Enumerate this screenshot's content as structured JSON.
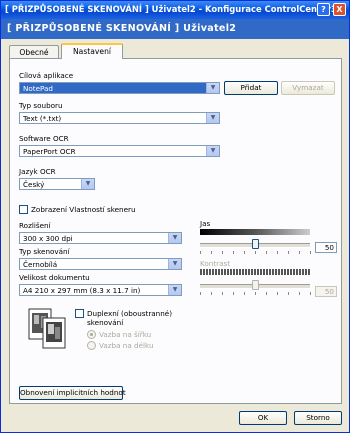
{
  "window": {
    "title": "[ PŘIZPŮSOBENÉ SKENOVÁNÍ ]  Uživatel2 - Konfigurace ControlCenter3",
    "help_label": "?",
    "close_label": "X"
  },
  "header": {
    "text": "[ PŘIZPŮSOBENÉ SKENOVÁNÍ ]  Uživatel2"
  },
  "tabs": [
    {
      "label": "Obecné",
      "active": false
    },
    {
      "label": "Nastavení",
      "active": true
    }
  ],
  "target_app": {
    "label": "Cílová aplikace",
    "value": "NotePad",
    "add_label": "Přidat",
    "delete_label": "Vymazat"
  },
  "file_type": {
    "label": "Typ souboru",
    "value": "Text (*.txt)"
  },
  "ocr_software": {
    "label": "Software OCR",
    "value": "PaperPort OCR"
  },
  "ocr_language": {
    "label": "Jazyk OCR",
    "value": "Český"
  },
  "show_scanner_props": {
    "label": "Zobrazení Vlastností skeneru",
    "checked": false
  },
  "resolution": {
    "label": "Rozlišení",
    "value": "300 x 300 dpi"
  },
  "scan_type": {
    "label": "Typ skenování",
    "value": "Černobílá"
  },
  "doc_size": {
    "label": "Velikost dokumentu",
    "value": "A4 210 x 297 mm (8.3 x 11.7 in)"
  },
  "duplex": {
    "label_line1": "Duplexní (oboustranné)",
    "label_line2": "skenování",
    "checked": false,
    "options": [
      {
        "label": "Vazba na šířku",
        "selected": true
      },
      {
        "label": "Vazba na délku",
        "selected": false
      }
    ]
  },
  "brightness": {
    "label": "Jas",
    "value": "50",
    "level": 0.5
  },
  "contrast": {
    "label": "Kontrast",
    "value": "50",
    "level": 0.5
  },
  "restore_defaults_label": "Obnovení implicitních hodnot",
  "ok_label": "OK",
  "cancel_label": "Storno",
  "icons": {
    "help": "help-icon",
    "close": "close-icon",
    "dropdown": "chevron-down-icon",
    "duplex": "duplex-pages-icon"
  },
  "colors": {
    "title_bar": "#0a58e0",
    "header_band": "#3169c6",
    "dialog_face": "#ece9d8",
    "selection": "#3169c6",
    "active_tab_accent": "#ffc83c"
  }
}
